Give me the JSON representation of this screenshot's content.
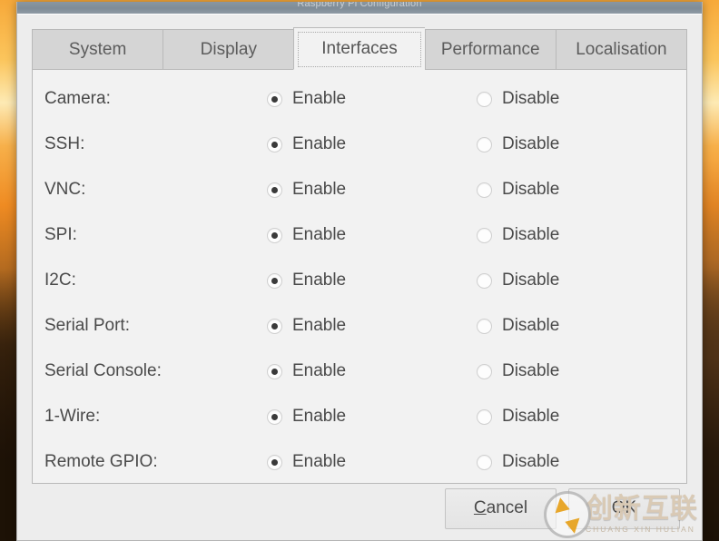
{
  "desktop": {
    "wallpaper_name": "sunset-wallpaper",
    "colors": {
      "sky_top": "#f7a93a",
      "sky_mid": "#fdeab4",
      "ground_bottom": "#241707"
    }
  },
  "window": {
    "titlebar_text": "Raspberry Pi Configuration",
    "background": "#ededed",
    "border_color": "#b4b4b4"
  },
  "tabs": [
    {
      "label": "System",
      "active": false
    },
    {
      "label": "Display",
      "active": false
    },
    {
      "label": "Interfaces",
      "active": true
    },
    {
      "label": "Performance",
      "active": false
    },
    {
      "label": "Localisation",
      "active": false
    }
  ],
  "interfaces": {
    "option_enable": "Enable",
    "option_disable": "Disable",
    "rows": [
      {
        "label": "Camera:",
        "value": "Enable"
      },
      {
        "label": "SSH:",
        "value": "Enable"
      },
      {
        "label": "VNC:",
        "value": "Enable"
      },
      {
        "label": "SPI:",
        "value": "Enable"
      },
      {
        "label": "I2C:",
        "value": "Enable"
      },
      {
        "label": "Serial Port:",
        "value": "Enable"
      },
      {
        "label": "Serial Console:",
        "value": "Enable"
      },
      {
        "label": "1-Wire:",
        "value": "Enable"
      },
      {
        "label": "Remote GPIO:",
        "value": "Enable"
      }
    ]
  },
  "buttons": {
    "cancel": {
      "mnemonic": "C",
      "rest": "ancel"
    },
    "ok": {
      "label": "OK"
    }
  },
  "watermark": {
    "chinese": "创新互联",
    "pinyin": "CHUANG XIN HULIAN"
  }
}
